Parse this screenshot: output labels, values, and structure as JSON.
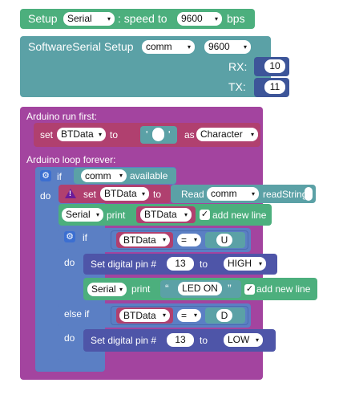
{
  "setup_block": {
    "label": "Setup",
    "port": "Serial",
    "colon_text": ": speed to",
    "speed": "9600",
    "unit": "bps"
  },
  "softserial_block": {
    "label": "SoftwareSerial Setup",
    "name": "comm",
    "speed": "9600",
    "rx_label": "RX:",
    "rx_value": "10",
    "tx_label": "TX:",
    "tx_value": "11"
  },
  "run_first": {
    "label": "Arduino run first:",
    "set_label": "set",
    "var": "BTData",
    "to_label": "to",
    "char_quote_open": "'",
    "char_quote_close": "'",
    "as_label": "as",
    "type": "Character"
  },
  "loop": {
    "label": "Arduino loop forever:",
    "if_label": "if",
    "do_label": "do",
    "serial_name": "comm",
    "available_label": "available",
    "set_label": "set",
    "var": "BTData",
    "to_label": "to",
    "read_label": "Read",
    "read_serial": "comm",
    "readstring_label": "readString",
    "print_port": "Serial",
    "print_label": "print",
    "print_var": "BTData",
    "add_new_line": "add new line",
    "check": "✓",
    "inner_if": "if",
    "inner_do": "do",
    "else_if": "else if",
    "do2": "do",
    "cond1_var": "BTData",
    "cond1_op": "=",
    "cond1_val": "U",
    "pin_label": "Set digital pin #",
    "pin1": "13",
    "pin_to": "to",
    "state1": "HIGH",
    "print2_port": "Serial",
    "print2_label": "print",
    "quote_open": "“",
    "string2": "LED ON",
    "quote_close": "”",
    "add_new_line2": "add new line",
    "cond2_var": "BTData",
    "cond2_op": "=",
    "cond2_val": "D",
    "pin2": "13",
    "state2": "LOW",
    "arrow": "▾",
    "gear": "⚙",
    "warn": "!"
  },
  "colors": {
    "serial": "#4caf7d",
    "softserial": "#5ba1a6",
    "main": "#a3449f",
    "logic": "#5b7fc4",
    "var": "#b0406f",
    "io": "#4e55a8",
    "text": "#6fa5a8"
  }
}
